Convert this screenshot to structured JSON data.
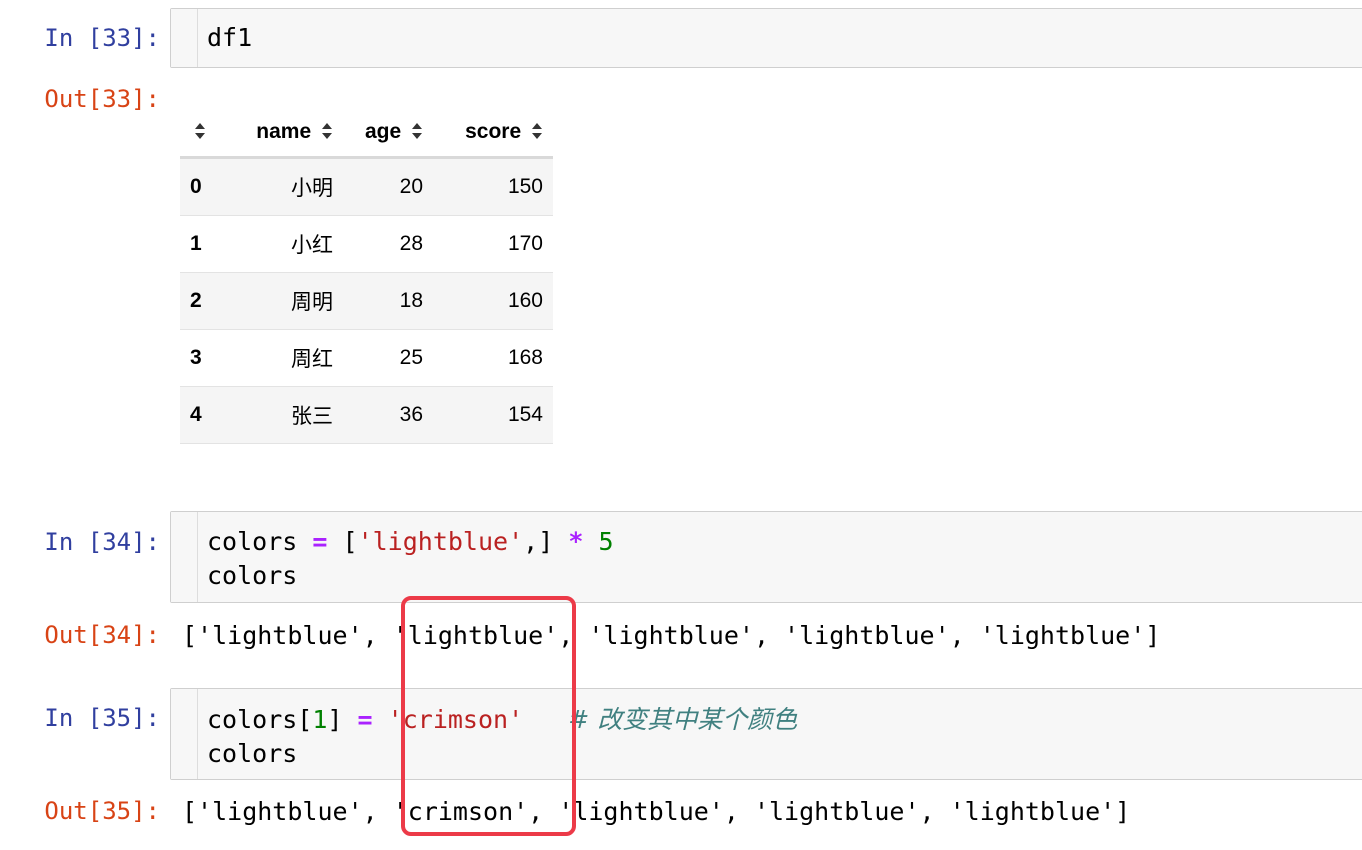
{
  "cells": [
    {
      "in_prompt": "In [33]:",
      "code_line1": "df1",
      "out_prompt": "Out[33]:",
      "dataframe": {
        "index_header": "",
        "columns": [
          "name",
          "age",
          "score"
        ],
        "rows": [
          {
            "index": "0",
            "name": "小明",
            "age": "20",
            "score": "150"
          },
          {
            "index": "1",
            "name": "小红",
            "age": "28",
            "score": "170"
          },
          {
            "index": "2",
            "name": "周明",
            "age": "18",
            "score": "160"
          },
          {
            "index": "3",
            "name": "周红",
            "age": "25",
            "score": "168"
          },
          {
            "index": "4",
            "name": "张三",
            "age": "36",
            "score": "154"
          }
        ]
      }
    },
    {
      "in_prompt": "In [34]:",
      "code_line1": {
        "var": "colors",
        "op": "=",
        "open": "[",
        "str": "'lightblue'",
        "close": ",]",
        "mul": "*",
        "num": "5"
      },
      "code_line2": "colors",
      "out_prompt": "Out[34]:",
      "output": "['lightblue', 'lightblue', 'lightblue', 'lightblue', 'lightblue']"
    },
    {
      "in_prompt": "In [35]:",
      "code_line1": {
        "var": "colors[",
        "num": "1",
        "close": "]",
        "op": "=",
        "str": "'crimson'",
        "comment": "# 改变其中某个颜色"
      },
      "code_line2": "colors",
      "out_prompt": "Out[35]:",
      "output": "['lightblue', 'crimson', 'lightblue', 'lightblue', 'lightblue']"
    }
  ],
  "colors": {
    "in_prompt": "#303f9f",
    "out_prompt": "#d84315",
    "highlight_box": "#ec3a48",
    "keyword_op": "#aa22ff",
    "string": "#ba2121",
    "number": "#008000",
    "comment": "#408080"
  },
  "icons": {
    "sort": "sort-arrows-icon"
  }
}
